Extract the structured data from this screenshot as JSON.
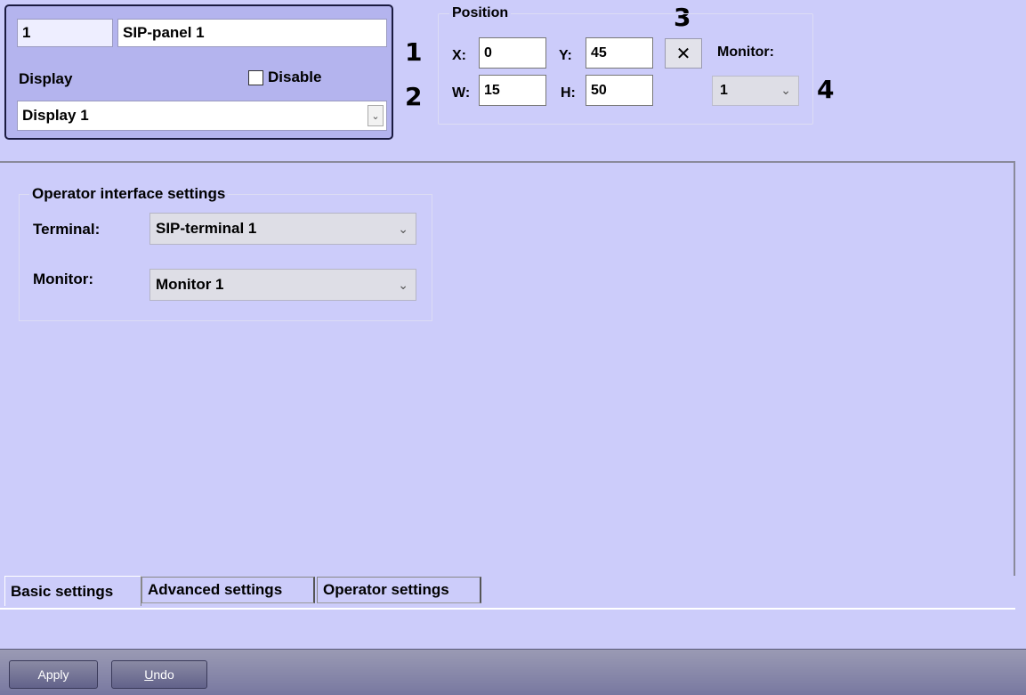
{
  "ident": {
    "id_value": "1",
    "name_value": "SIP-panel 1",
    "display_label": "Display",
    "disable_label": "Disable",
    "disable_checked": false,
    "display_value": "Display 1"
  },
  "callouts": [
    "1",
    "2",
    "3",
    "4"
  ],
  "position": {
    "title": "Position",
    "x_label": "X:",
    "x_value": "0",
    "y_label": "Y:",
    "y_value": "45",
    "w_label": "W:",
    "w_value": "15",
    "h_label": "H:",
    "h_value": "50",
    "reset_glyph": "✕",
    "monitor_label": "Monitor:",
    "monitor_value": "1"
  },
  "operator": {
    "title": "Operator interface settings",
    "terminal_label": "Terminal:",
    "terminal_value": "SIP-terminal 1",
    "monitor_label": "Monitor:",
    "monitor_value": "Monitor 1"
  },
  "tabs": [
    {
      "label": "Basic settings",
      "active": true
    },
    {
      "label": "Advanced settings",
      "active": false
    },
    {
      "label": "Operator settings",
      "active": false
    }
  ],
  "buttons": {
    "apply": "Apply",
    "undo": "Undo"
  },
  "colors": {
    "background": "#ccccfa",
    "panel": "#b4b4ee",
    "bottom_bar": "#8a8aa8"
  }
}
